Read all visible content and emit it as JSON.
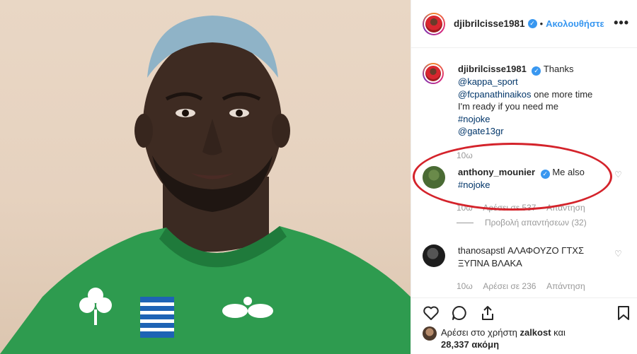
{
  "post": {
    "author": "djibrilcisse1981",
    "follow_label": "Ακολουθήστε",
    "separator": "•",
    "more_label": "•••"
  },
  "caption": {
    "username": "djibrilcisse1981",
    "lines": [
      "Thanks",
      "@kappa_sport",
      "@fcpanathinaikos",
      "one more time",
      "I'm ready if you need me",
      "#nojoke",
      "@gate13gr"
    ],
    "time": "10ω"
  },
  "comments": [
    {
      "username": "anthony_mounier",
      "text": "Me also",
      "emoji": "",
      "hashtag": "#nojoke",
      "time": "10ω",
      "likes": "Αρέσει σε 537",
      "reply": "Απάντηση",
      "view_replies": "Προβολή απαντήσεων (32)"
    },
    {
      "username": "thanosapstl",
      "text_line1": "ΑΛΑΦΟΥΖΟ ΓΤΧΣ",
      "text_line2": "ΞΥΠΝΑ ΒΛΑΚΑ",
      "time": "10ω",
      "likes": "Αρέσει σε 236",
      "reply": "Απάντηση"
    }
  ],
  "likes_summary": {
    "line1_prefix": "Αρέσει στο χρήστη",
    "liker": "zalkost",
    "line1_suffix": "και",
    "line2": "28,337 ακόμη"
  },
  "icons": [
    "heart-icon",
    "comment-icon",
    "share-icon",
    "bookmark-icon",
    "verified-icon",
    "more-options-icon"
  ],
  "colors": {
    "accent": "#3897f0",
    "link": "#003569",
    "muted": "#999999",
    "annotation": "#d4232b",
    "jersey": "#2e9b4f"
  }
}
